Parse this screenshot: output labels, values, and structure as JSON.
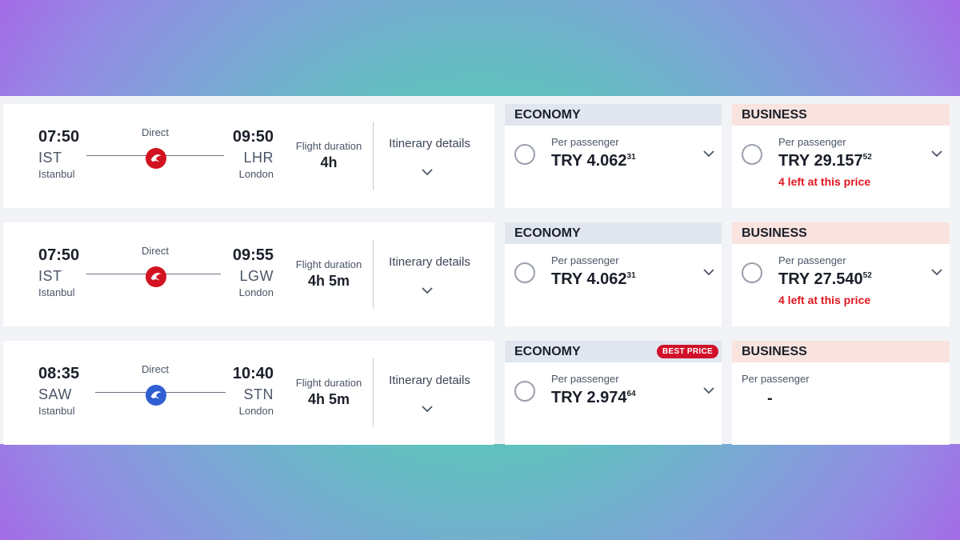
{
  "labels": {
    "direct": "Direct",
    "flight_duration": "Flight duration",
    "itinerary_details": "Itinerary details",
    "per_passenger": "Per passenger",
    "economy": "ECONOMY",
    "business": "BUSINESS"
  },
  "flights": [
    {
      "dep_time": "07:50",
      "dep_code": "IST",
      "dep_city": "Istanbul",
      "arr_time": "09:50",
      "arr_code": "LHR",
      "arr_city": "London",
      "duration": "4h",
      "airline_icon": "turkish-airlines-logo",
      "economy": {
        "currency": "TRY",
        "price": "4.062",
        "cents": "31"
      },
      "business": {
        "currency": "TRY",
        "price": "29.157",
        "cents": "52",
        "availability": "4 left at this price"
      }
    },
    {
      "dep_time": "07:50",
      "dep_code": "IST",
      "dep_city": "Istanbul",
      "arr_time": "09:55",
      "arr_code": "LGW",
      "arr_city": "London",
      "duration": "4h 5m",
      "airline_icon": "turkish-airlines-logo",
      "economy": {
        "currency": "TRY",
        "price": "4.062",
        "cents": "31"
      },
      "business": {
        "currency": "TRY",
        "price": "27.540",
        "cents": "52",
        "availability": "4 left at this price"
      }
    },
    {
      "dep_time": "08:35",
      "dep_code": "SAW",
      "dep_city": "Istanbul",
      "arr_time": "10:40",
      "arr_code": "STN",
      "arr_city": "London",
      "duration": "4h 5m",
      "airline_icon": "ajet-logo",
      "economy": {
        "currency": "TRY",
        "price": "2.974",
        "cents": "64",
        "badge": "BEST PRICE"
      },
      "business": {
        "unavailable": "-"
      }
    }
  ],
  "colors": {
    "economy_header": "#e1e6ee",
    "business_header": "#f8e3de",
    "availability_red": "#e0161e",
    "best_price_badge": "#d0102a",
    "turkish_red": "#d21221",
    "ajet_blue": "#2f5fd0"
  }
}
